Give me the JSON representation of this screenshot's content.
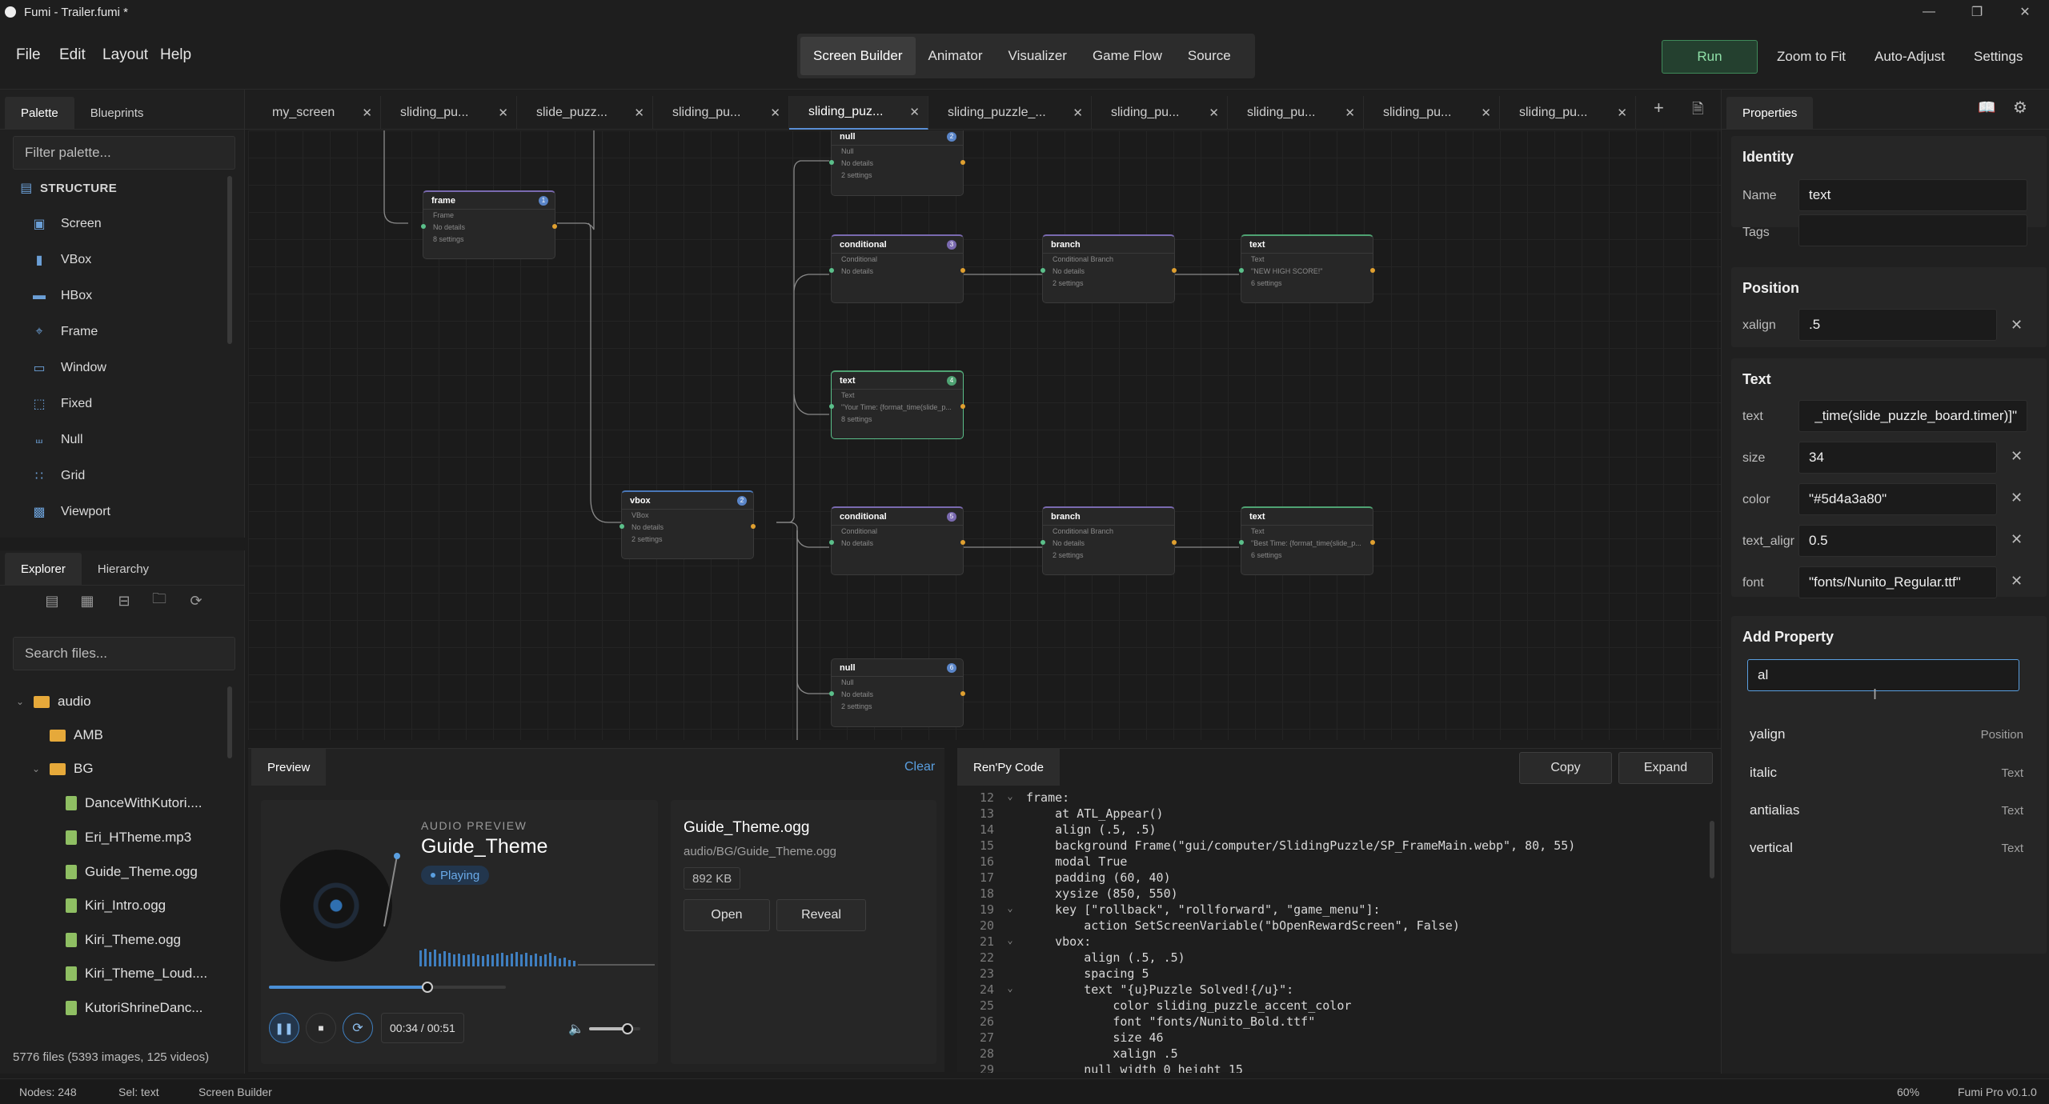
{
  "window": {
    "title": "Fumi - Trailer.fumi *"
  },
  "menu": [
    "File",
    "Edit",
    "Layout",
    "Help"
  ],
  "modes": {
    "items": [
      "Screen Builder",
      "Animator",
      "Visualizer",
      "Game Flow",
      "Source"
    ],
    "active": "Screen Builder"
  },
  "toolbar": {
    "run": "Run",
    "zoom_fit": "Zoom to Fit",
    "auto_adjust": "Auto-Adjust",
    "settings": "Settings"
  },
  "palette": {
    "tabs": [
      "Palette",
      "Blueprints"
    ],
    "filter_placeholder": "Filter palette...",
    "section": "STRUCTURE",
    "items": [
      "Screen",
      "VBox",
      "HBox",
      "Frame",
      "Window",
      "Fixed",
      "Null",
      "Grid",
      "Viewport"
    ]
  },
  "explorer": {
    "tabs": [
      "Explorer",
      "Hierarchy"
    ],
    "search_placeholder": "Search files...",
    "tree": {
      "audio": "audio",
      "amb": "AMB",
      "bg": "BG",
      "files": [
        "DanceWithKutori....",
        "Eri_HTheme.mp3",
        "Guide_Theme.ogg",
        "Kiri_Intro.ogg",
        "Kiri_Theme.ogg",
        "Kiri_Theme_Loud....",
        "KutoriShrineDanc..."
      ]
    },
    "summary": "5776 files (5393 images, 125 videos)"
  },
  "tabs": [
    {
      "label": "my_screen"
    },
    {
      "label": "sliding_pu..."
    },
    {
      "label": "slide_puzz..."
    },
    {
      "label": "sliding_pu..."
    },
    {
      "label": "sliding_puz..."
    },
    {
      "label": "sliding_puzzle_..."
    },
    {
      "label": "sliding_pu..."
    },
    {
      "label": "sliding_pu..."
    },
    {
      "label": "sliding_pu..."
    },
    {
      "label": "sliding_pu..."
    }
  ],
  "nodes": {
    "frame": {
      "title": "frame",
      "badge": "1",
      "lines": [
        "Frame",
        "No details",
        "8 settings"
      ]
    },
    "vbox": {
      "title": "vbox",
      "badge": "2",
      "lines": [
        "VBox",
        "No details",
        "2 settings"
      ]
    },
    "null1": {
      "title": "null",
      "badge": "2",
      "lines": [
        "Null",
        "No details",
        "2 settings"
      ]
    },
    "cond1": {
      "title": "conditional",
      "badge": "3",
      "lines": [
        "Conditional",
        "No details"
      ]
    },
    "branch1": {
      "title": "branch",
      "lines": [
        "Conditional Branch",
        "No details",
        "2 settings"
      ]
    },
    "text1": {
      "title": "text",
      "lines": [
        "Text",
        "\"NEW HIGH SCORE!\"",
        "6 settings"
      ]
    },
    "text2": {
      "title": "text",
      "badge": "4",
      "lines": [
        "Text",
        "\"Your Time: {format_time(slide_p...",
        "8 settings"
      ]
    },
    "cond2": {
      "title": "conditional",
      "badge": "5",
      "lines": [
        "Conditional",
        "No details"
      ]
    },
    "branch2": {
      "title": "branch",
      "lines": [
        "Conditional Branch",
        "No details",
        "2 settings"
      ]
    },
    "text3": {
      "title": "text",
      "lines": [
        "Text",
        "\"Best Time: {format_time(slide_p...",
        "6 settings"
      ]
    },
    "null2": {
      "title": "null",
      "badge": "6",
      "lines": [
        "Null",
        "No details",
        "2 settings"
      ]
    }
  },
  "preview": {
    "tab": "Preview",
    "clear": "Clear",
    "kicker": "AUDIO PREVIEW",
    "track": "Guide_Theme",
    "status": "Playing",
    "progress": 0.67,
    "volume": 0.75,
    "time": "00:34 / 00:51",
    "file_name": "Guide_Theme.ogg",
    "file_path": "audio/BG/Guide_Theme.ogg",
    "file_size": "892 KB",
    "open": "Open",
    "reveal": "Reveal"
  },
  "code": {
    "tab": "Ren'Py Code",
    "copy": "Copy",
    "expand": "Expand",
    "lines": [
      {
        "n": "12",
        "fold": "⌄",
        "text": "frame:"
      },
      {
        "n": "13",
        "fold": "",
        "text": "    at ATL_Appear()"
      },
      {
        "n": "14",
        "fold": "",
        "text": "    align (.5, .5)"
      },
      {
        "n": "15",
        "fold": "",
        "text": "    background Frame(\"gui/computer/SlidingPuzzle/SP_FrameMain.webp\", 80, 55)"
      },
      {
        "n": "16",
        "fold": "",
        "text": "    modal True"
      },
      {
        "n": "17",
        "fold": "",
        "text": "    padding (60, 40)"
      },
      {
        "n": "18",
        "fold": "",
        "text": "    xysize (850, 550)"
      },
      {
        "n": "19",
        "fold": "⌄",
        "text": "    key [\"rollback\", \"rollforward\", \"game_menu\"]:"
      },
      {
        "n": "20",
        "fold": "",
        "text": "        action SetScreenVariable(\"bOpenRewardScreen\", False)"
      },
      {
        "n": "21",
        "fold": "⌄",
        "text": "    vbox:"
      },
      {
        "n": "22",
        "fold": "",
        "text": "        align (.5, .5)"
      },
      {
        "n": "23",
        "fold": "",
        "text": "        spacing 5"
      },
      {
        "n": "24",
        "fold": "⌄",
        "text": "        text \"{u}Puzzle Solved!{/u}\":"
      },
      {
        "n": "25",
        "fold": "",
        "text": "            color sliding_puzzle_accent_color"
      },
      {
        "n": "26",
        "fold": "",
        "text": "            font \"fonts/Nunito_Bold.ttf\""
      },
      {
        "n": "27",
        "fold": "",
        "text": "            size 46"
      },
      {
        "n": "28",
        "fold": "",
        "text": "            xalign .5"
      },
      {
        "n": "29",
        "fold": "",
        "text": "        null width 0 height 15"
      }
    ]
  },
  "properties": {
    "tab": "Properties",
    "identity": {
      "title": "Identity",
      "name_label": "Name",
      "name_value": "text",
      "tags_label": "Tags",
      "tags_value": ""
    },
    "position": {
      "title": "Position",
      "xalign_label": "xalign",
      "xalign_value": ".5"
    },
    "text": {
      "title": "Text",
      "rows": [
        {
          "label": "text",
          "value": "_time(slide_puzzle_board.timer)]\""
        },
        {
          "label": "size",
          "value": "34"
        },
        {
          "label": "color",
          "value": "\"#5d4a3a80\""
        },
        {
          "label": "text_aligr",
          "value": "0.5"
        },
        {
          "label": "font",
          "value": "\"fonts/Nunito_Regular.ttf\""
        }
      ]
    },
    "add": {
      "title": "Add Property",
      "query": "al",
      "suggestions": [
        {
          "name": "yalign",
          "category": "Position"
        },
        {
          "name": "italic",
          "category": "Text"
        },
        {
          "name": "antialias",
          "category": "Text"
        },
        {
          "name": "vertical",
          "category": "Text"
        }
      ]
    }
  },
  "status": {
    "nodes": "Nodes: 248",
    "sel": "Sel: text",
    "mode": "Screen Builder",
    "zoom": "60%",
    "version": "Fumi Pro v0.1.0"
  },
  "colors": {
    "accent_green": "#5bbf8a",
    "accent_blue": "#5a8fd6",
    "pin_out": "#e0a030"
  }
}
